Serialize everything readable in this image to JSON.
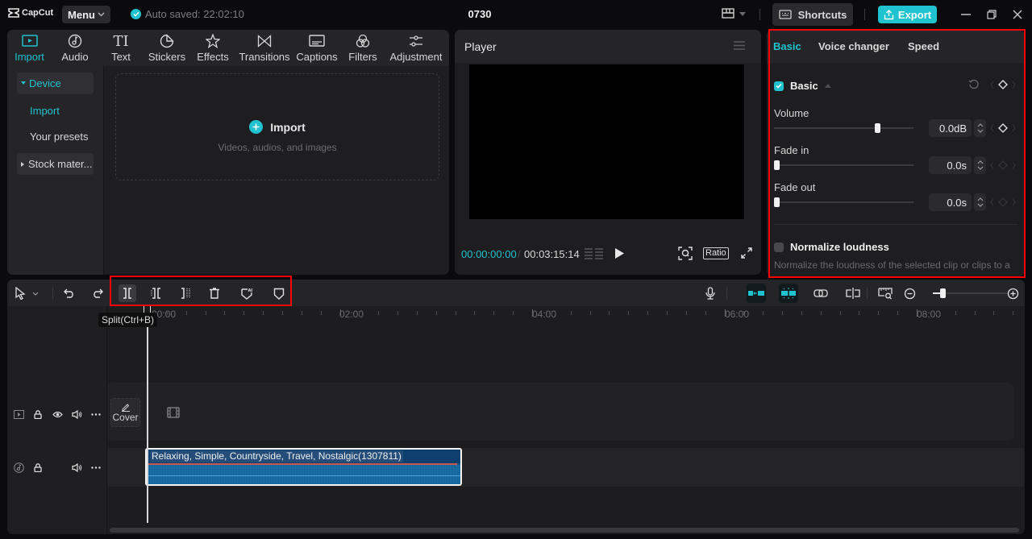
{
  "titlebar": {
    "app_name": "CapCut",
    "menu_label": "Menu",
    "autosave_text": "Auto saved: 22:02:10",
    "project_title": "0730",
    "shortcuts_label": "Shortcuts",
    "export_label": "Export"
  },
  "media_tools": [
    {
      "label": "Import",
      "icon": "import-icon",
      "active": true
    },
    {
      "label": "Audio",
      "icon": "audio-icon"
    },
    {
      "label": "Text",
      "icon": "text-icon"
    },
    {
      "label": "Stickers",
      "icon": "stickers-icon"
    },
    {
      "label": "Effects",
      "icon": "effects-icon"
    },
    {
      "label": "Transitions",
      "icon": "transitions-icon"
    },
    {
      "label": "Captions",
      "icon": "captions-icon"
    },
    {
      "label": "Filters",
      "icon": "filters-icon"
    },
    {
      "label": "Adjustment",
      "icon": "adjustment-icon"
    }
  ],
  "media_sidebar": {
    "device_label": "Device",
    "import_label": "Import",
    "presets_label": "Your presets",
    "stock_label": "Stock mater..."
  },
  "import_area": {
    "title": "Import",
    "subtitle": "Videos, audios, and images"
  },
  "player": {
    "title": "Player",
    "current_time": "00:00:00:00",
    "separator": "/",
    "total_time": "00:03:15:14",
    "ratio_label": "Ratio"
  },
  "details": {
    "tabs": [
      {
        "label": "Basic",
        "active": true
      },
      {
        "label": "Voice changer"
      },
      {
        "label": "Speed"
      }
    ],
    "section_title": "Basic",
    "section_enabled": true,
    "volume": {
      "label": "Volume",
      "value": "0.0dB",
      "slider_fraction": 0.75
    },
    "fade_in": {
      "label": "Fade in",
      "value": "0.0s",
      "slider_fraction": 0.0
    },
    "fade_out": {
      "label": "Fade out",
      "value": "0.0s",
      "slider_fraction": 0.0
    },
    "normalize": {
      "label": "Normalize loudness",
      "enabled": false,
      "description": "Normalize the loudness of the selected clip or clips to a"
    }
  },
  "timeline": {
    "tooltip": "Split(Ctrl+B)",
    "ruler_labels": [
      "00:00",
      "02:00",
      "04:00",
      "06:00",
      "08:00"
    ],
    "cover_label": "Cover",
    "audio_clip_name": "Relaxing, Simple, Countryside, Travel, Nostalgic(1307811)",
    "zoom_fraction": 0.1
  },
  "colors": {
    "accent": "#1fc2cf",
    "highlight_box": "#ff0000",
    "audio_clip": "#14558a"
  }
}
